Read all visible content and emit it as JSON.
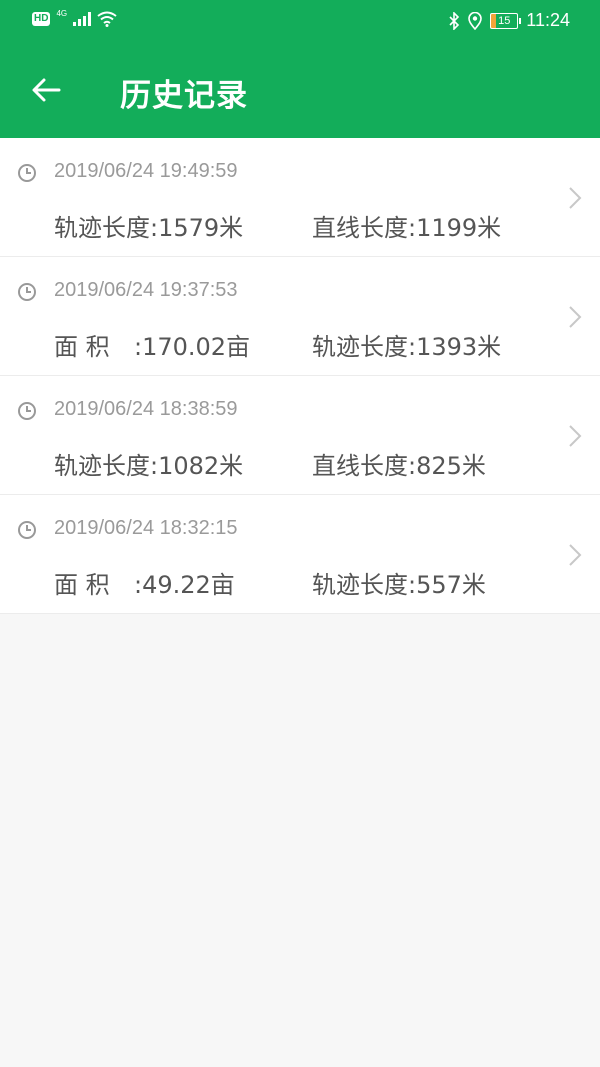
{
  "status_bar": {
    "hd": "HD",
    "network": "4G",
    "battery": "15",
    "time": "11:24"
  },
  "header": {
    "title": "历史记录"
  },
  "records": [
    {
      "datetime": "2019/06/24 19:49:59",
      "stats": [
        {
          "label": "轨迹长度",
          "value": ":1579米"
        },
        {
          "label": "直线长度",
          "value": ":1199米"
        }
      ]
    },
    {
      "datetime": "2019/06/24 19:37:53",
      "stats": [
        {
          "label": "面 积",
          "value": ":170.02亩"
        },
        {
          "label": "轨迹长度",
          "value": ":1393米"
        }
      ]
    },
    {
      "datetime": "2019/06/24 18:38:59",
      "stats": [
        {
          "label": "轨迹长度",
          "value": ":1082米"
        },
        {
          "label": "直线长度",
          "value": ":825米"
        }
      ]
    },
    {
      "datetime": "2019/06/24 18:32:15",
      "stats": [
        {
          "label": "面 积",
          "value": ":49.22亩"
        },
        {
          "label": "轨迹长度",
          "value": ":557米"
        }
      ]
    }
  ],
  "colors": {
    "accent": "#13ad5a",
    "text": "#555555",
    "muted": "#9a9a9a"
  },
  "icons": [
    "back-arrow-icon",
    "clock-icon",
    "chevron-right-icon",
    "bluetooth-icon",
    "location-icon",
    "wifi-icon",
    "signal-icon",
    "battery-icon"
  ]
}
